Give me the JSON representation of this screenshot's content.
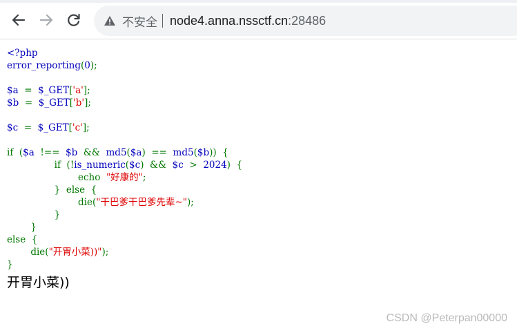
{
  "browser": {
    "security_label": "不安全",
    "url_host": "node4.anna.nssctf.cn",
    "url_port": ":28486"
  },
  "code_lines": [
    [
      {
        "t": "<?php",
        "c": "default"
      }
    ],
    [
      {
        "t": "error_reporting",
        "c": "default"
      },
      {
        "t": "(",
        "c": "keyword"
      },
      {
        "t": "0",
        "c": "default"
      },
      {
        "t": ");",
        "c": "keyword"
      }
    ],
    [],
    [
      {
        "t": "$a  ",
        "c": "default"
      },
      {
        "t": "=  ",
        "c": "keyword"
      },
      {
        "t": "$_GET",
        "c": "default"
      },
      {
        "t": "[",
        "c": "keyword"
      },
      {
        "t": "'a'",
        "c": "string"
      },
      {
        "t": "];",
        "c": "keyword"
      }
    ],
    [
      {
        "t": "$b  ",
        "c": "default"
      },
      {
        "t": "=  ",
        "c": "keyword"
      },
      {
        "t": "$_GET",
        "c": "default"
      },
      {
        "t": "[",
        "c": "keyword"
      },
      {
        "t": "'b'",
        "c": "string"
      },
      {
        "t": "];",
        "c": "keyword"
      }
    ],
    [],
    [
      {
        "t": "$c  ",
        "c": "default"
      },
      {
        "t": "=  ",
        "c": "keyword"
      },
      {
        "t": "$_GET",
        "c": "default"
      },
      {
        "t": "[",
        "c": "keyword"
      },
      {
        "t": "'c'",
        "c": "string"
      },
      {
        "t": "];",
        "c": "keyword"
      }
    ],
    [],
    [
      {
        "t": "if  (",
        "c": "keyword"
      },
      {
        "t": "$a  ",
        "c": "default"
      },
      {
        "t": "!==  ",
        "c": "keyword"
      },
      {
        "t": "$b  ",
        "c": "default"
      },
      {
        "t": "&&  ",
        "c": "keyword"
      },
      {
        "t": "md5",
        "c": "default"
      },
      {
        "t": "(",
        "c": "keyword"
      },
      {
        "t": "$a",
        "c": "default"
      },
      {
        "t": ")  ==  ",
        "c": "keyword"
      },
      {
        "t": "md5",
        "c": "default"
      },
      {
        "t": "(",
        "c": "keyword"
      },
      {
        "t": "$b",
        "c": "default"
      },
      {
        "t": "))  {",
        "c": "keyword"
      }
    ],
    [
      {
        "t": "                if  (!",
        "c": "keyword"
      },
      {
        "t": "is_numeric",
        "c": "default"
      },
      {
        "t": "(",
        "c": "keyword"
      },
      {
        "t": "$c",
        "c": "default"
      },
      {
        "t": ")  &&  ",
        "c": "keyword"
      },
      {
        "t": "$c  ",
        "c": "default"
      },
      {
        "t": ">  ",
        "c": "keyword"
      },
      {
        "t": "2024",
        "c": "default"
      },
      {
        "t": ")  {",
        "c": "keyword"
      }
    ],
    [
      {
        "t": "                        echo  ",
        "c": "keyword"
      },
      {
        "t": "\"好康的\"",
        "c": "string"
      },
      {
        "t": ";",
        "c": "keyword"
      }
    ],
    [
      {
        "t": "                }  else  {",
        "c": "keyword"
      }
    ],
    [
      {
        "t": "                        die",
        "c": "keyword"
      },
      {
        "t": "(",
        "c": "keyword"
      },
      {
        "t": "\"干巴爹干巴爹先辈~\"",
        "c": "string"
      },
      {
        "t": ");",
        "c": "keyword"
      }
    ],
    [
      {
        "t": "                }",
        "c": "keyword"
      }
    ],
    [
      {
        "t": "        }",
        "c": "keyword"
      }
    ],
    [
      {
        "t": "else  {",
        "c": "keyword"
      }
    ],
    [
      {
        "t": "        die",
        "c": "keyword"
      },
      {
        "t": "(",
        "c": "keyword"
      },
      {
        "t": "\"开胃小菜))\"",
        "c": "string"
      },
      {
        "t": ");",
        "c": "keyword"
      }
    ],
    [
      {
        "t": "}",
        "c": "keyword"
      }
    ]
  ],
  "output_text": "开胃小菜))",
  "watermark": "CSDN @Peterpan00000",
  "colors": {
    "default": "#0000bb",
    "keyword": "#007700",
    "string": "#dd0000"
  }
}
